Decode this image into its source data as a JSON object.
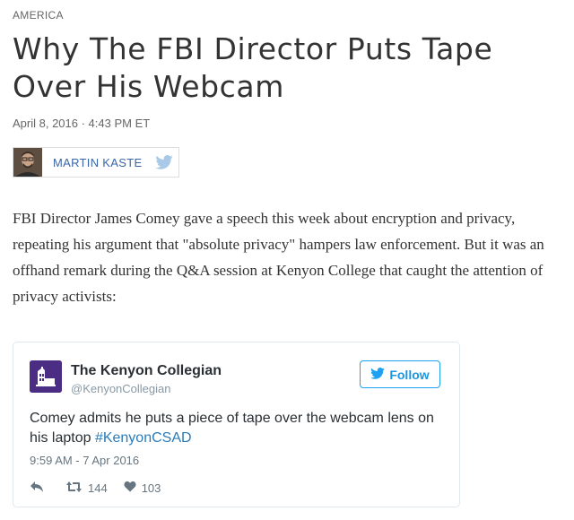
{
  "article": {
    "section": "AMERICA",
    "headline": "Why The FBI Director Puts Tape Over His Webcam",
    "dateline": "April 8, 2016 · 4:43 PM ET",
    "author": "MARTIN KASTE",
    "author_social_icon": "twitter-bird-icon",
    "body": "FBI Director James Comey gave a speech this week about encryption and privacy, repeating his argument that \"absolute privacy\" hampers law enforcement. But it was an offhand remark during the Q&A session at Kenyon College that caught the attention of privacy activists:"
  },
  "tweet": {
    "user_name": "The Kenyon Collegian",
    "handle": "@KenyonCollegian",
    "follow_label": "Follow",
    "text": "Comey admits he puts a piece of tape over the webcam lens on his laptop ",
    "hashtag": "#KenyonCSAD",
    "timestamp": "9:59 AM - 7 Apr 2016",
    "retweets": "144",
    "likes": "103",
    "icons": {
      "reply": "reply-arrow-icon",
      "retweet": "retweet-icon",
      "like": "heart-icon",
      "follow": "twitter-bird-icon"
    }
  },
  "colors": {
    "link": "#3a66a7",
    "twitter_blue": "#1da1f2",
    "hashtag": "#2b7bb9",
    "muted": "#8899a6",
    "body_text": "#333333"
  }
}
